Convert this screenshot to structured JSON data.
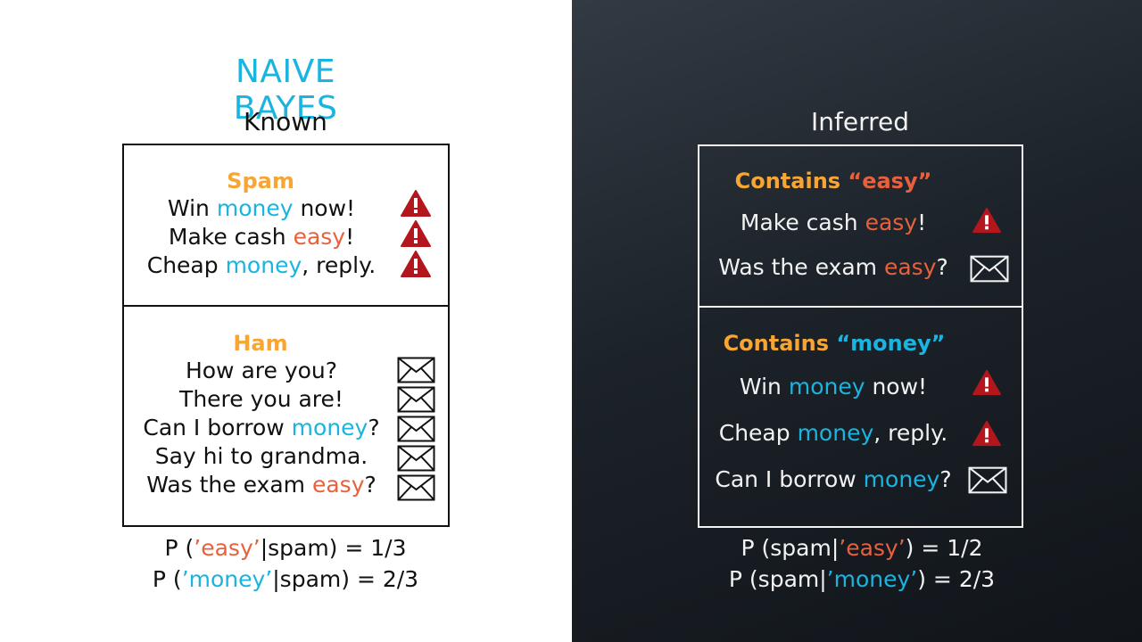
{
  "title": "NAIVE BAYES",
  "known": {
    "heading": "Known",
    "spam": {
      "label": "Spam",
      "rows": [
        {
          "pre": "Win ",
          "word": "money",
          "post": " now!",
          "kw": "money",
          "icon": "warning-icon"
        },
        {
          "pre": "Make cash ",
          "word": "easy",
          "post": "!",
          "kw": "easy",
          "icon": "warning-icon"
        },
        {
          "pre": "Cheap ",
          "word": "money",
          "post": ", reply.",
          "kw": "money",
          "icon": "warning-icon"
        }
      ]
    },
    "ham": {
      "label": "Ham",
      "rows": [
        {
          "pre": "How are you?",
          "word": "",
          "post": "",
          "kw": "",
          "icon": "envelope-icon"
        },
        {
          "pre": "There you are!",
          "word": "",
          "post": "",
          "kw": "",
          "icon": "envelope-icon"
        },
        {
          "pre": "Can I borrow ",
          "word": "money",
          "post": "?",
          "kw": "money",
          "icon": "envelope-icon"
        },
        {
          "pre": "Say hi to grandma.",
          "word": "",
          "post": "",
          "kw": "",
          "icon": "envelope-icon"
        },
        {
          "pre": "Was the exam ",
          "word": "easy",
          "post": "?",
          "kw": "easy",
          "icon": "envelope-icon"
        }
      ]
    },
    "formulas": [
      {
        "pre": "P (",
        "word": "’easy’",
        "post": "|spam) = 1/3",
        "kw": "easy"
      },
      {
        "pre": "P (",
        "word": "’money’",
        "post": "|spam) = 2/3",
        "kw": "money"
      }
    ]
  },
  "inferred": {
    "heading": "Inferred",
    "easy_section": {
      "label_pre": "Contains ",
      "label_word": "“easy”",
      "kw": "easy",
      "rows": [
        {
          "pre": "Make cash ",
          "word": "easy",
          "post": "!",
          "kw": "easy",
          "icon": "warning-icon"
        },
        {
          "pre": "Was the exam ",
          "word": "easy",
          "post": "?",
          "kw": "easy",
          "icon": "envelope-icon"
        }
      ]
    },
    "money_section": {
      "label_pre": "Contains ",
      "label_word": "“money”",
      "kw": "money",
      "rows": [
        {
          "pre": "Win ",
          "word": "money",
          "post": " now!",
          "kw": "money",
          "icon": "warning-icon"
        },
        {
          "pre": "Cheap ",
          "word": "money",
          "post": ", reply.",
          "kw": "money",
          "icon": "warning-icon"
        },
        {
          "pre": "Can I borrow ",
          "word": "money",
          "post": "?",
          "kw": "money",
          "icon": "envelope-icon"
        }
      ]
    },
    "formulas": [
      {
        "pre": "P (spam|",
        "word": "’easy’",
        "post": ") = 1/2",
        "kw": "easy"
      },
      {
        "pre": "P (spam|",
        "word": "’money’",
        "post": ") = 2/3",
        "kw": "money"
      }
    ]
  },
  "colors": {
    "title": "#1ab4e0",
    "section_label": "#f7a533",
    "money": "#1ab4e0",
    "easy": "#e8603c",
    "warning": "#b3161c"
  }
}
